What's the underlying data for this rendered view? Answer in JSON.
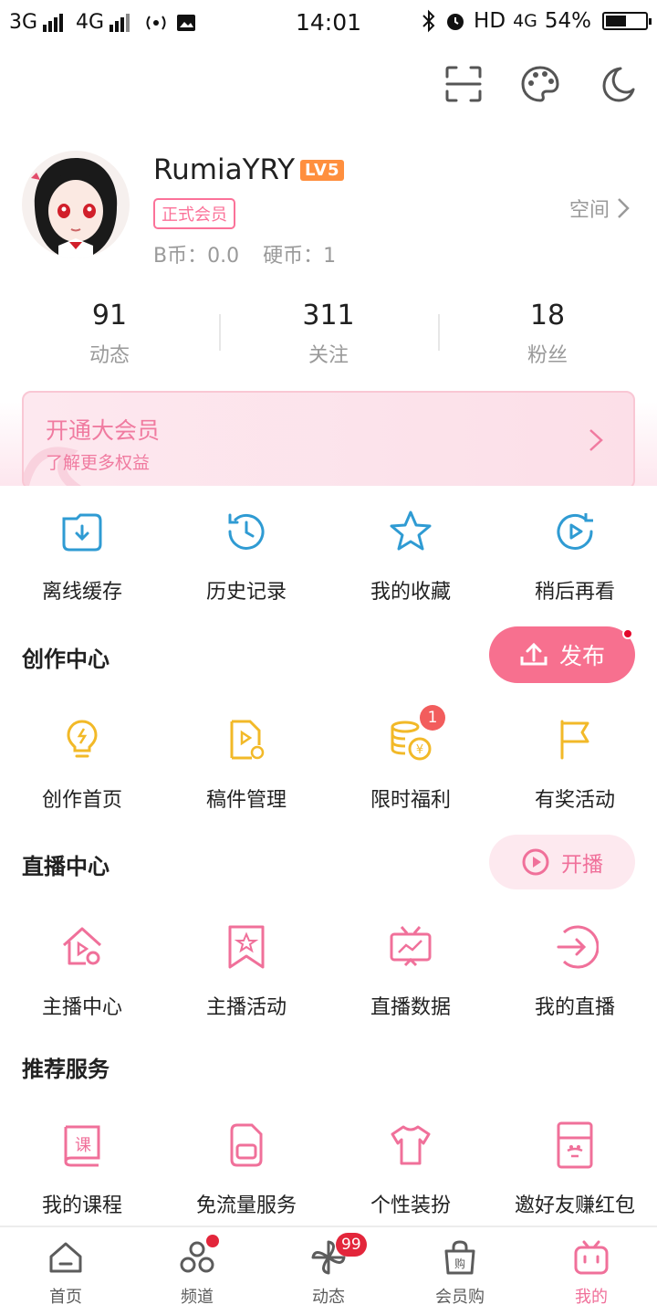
{
  "status_bar": {
    "network1": "3G",
    "network2": "4G",
    "time": "14:01",
    "hd": "HD",
    "network3": "4G",
    "battery": "54%"
  },
  "top_icons": [
    "scan-icon",
    "palette-icon",
    "moon-icon"
  ],
  "profile": {
    "username": "RumiaYRY",
    "level": "LV5",
    "vip_badge": "正式会员",
    "b_coin": "B币：0.0",
    "coin": "硬币：1",
    "space_link": "空间"
  },
  "stats": [
    {
      "value": "91",
      "label": "动态"
    },
    {
      "value": "311",
      "label": "关注"
    },
    {
      "value": "18",
      "label": "粉丝"
    }
  ],
  "vip_banner": {
    "title": "开通大会员",
    "subtitle": "了解更多权益"
  },
  "quick_actions": [
    {
      "label": "离线缓存",
      "icon": "download-folder-icon"
    },
    {
      "label": "历史记录",
      "icon": "history-clock-icon"
    },
    {
      "label": "我的收藏",
      "icon": "star-icon"
    },
    {
      "label": "稍后再看",
      "icon": "watch-later-icon"
    }
  ],
  "creation": {
    "title": "创作中心",
    "publish_label": "发布",
    "items": [
      {
        "label": "创作首页",
        "icon": "lightbulb-icon"
      },
      {
        "label": "稿件管理",
        "icon": "manuscript-icon"
      },
      {
        "label": "限时福利",
        "icon": "coins-icon",
        "badge": "1"
      },
      {
        "label": "有奖活动",
        "icon": "flag-icon"
      }
    ]
  },
  "live": {
    "title": "直播中心",
    "start_label": "开播",
    "items": [
      {
        "label": "主播中心",
        "icon": "streamer-home-icon"
      },
      {
        "label": "主播活动",
        "icon": "bookmark-star-icon"
      },
      {
        "label": "直播数据",
        "icon": "tv-chart-icon"
      },
      {
        "label": "我的直播",
        "icon": "enter-arrow-icon"
      }
    ]
  },
  "services": {
    "title": "推荐服务",
    "items": [
      {
        "label": "我的课程",
        "icon": "course-book-icon"
      },
      {
        "label": "免流量服务",
        "icon": "sim-card-icon"
      },
      {
        "label": "个性装扮",
        "icon": "tshirt-icon"
      },
      {
        "label": "邀好友赚红包",
        "icon": "red-envelope-icon"
      }
    ]
  },
  "bottom_nav": [
    {
      "label": "首页",
      "icon": "home-icon"
    },
    {
      "label": "频道",
      "icon": "channel-icon"
    },
    {
      "label": "动态",
      "icon": "pinwheel-icon",
      "count": "99"
    },
    {
      "label": "会员购",
      "icon": "shopping-bag-icon"
    },
    {
      "label": "我的",
      "icon": "tv-face-icon",
      "active": true
    }
  ],
  "colors": {
    "accent": "#fb7299",
    "live_blue": "#2f9bd3",
    "creation_yellow": "#f2b928",
    "badge_red": "#f25d5d"
  }
}
